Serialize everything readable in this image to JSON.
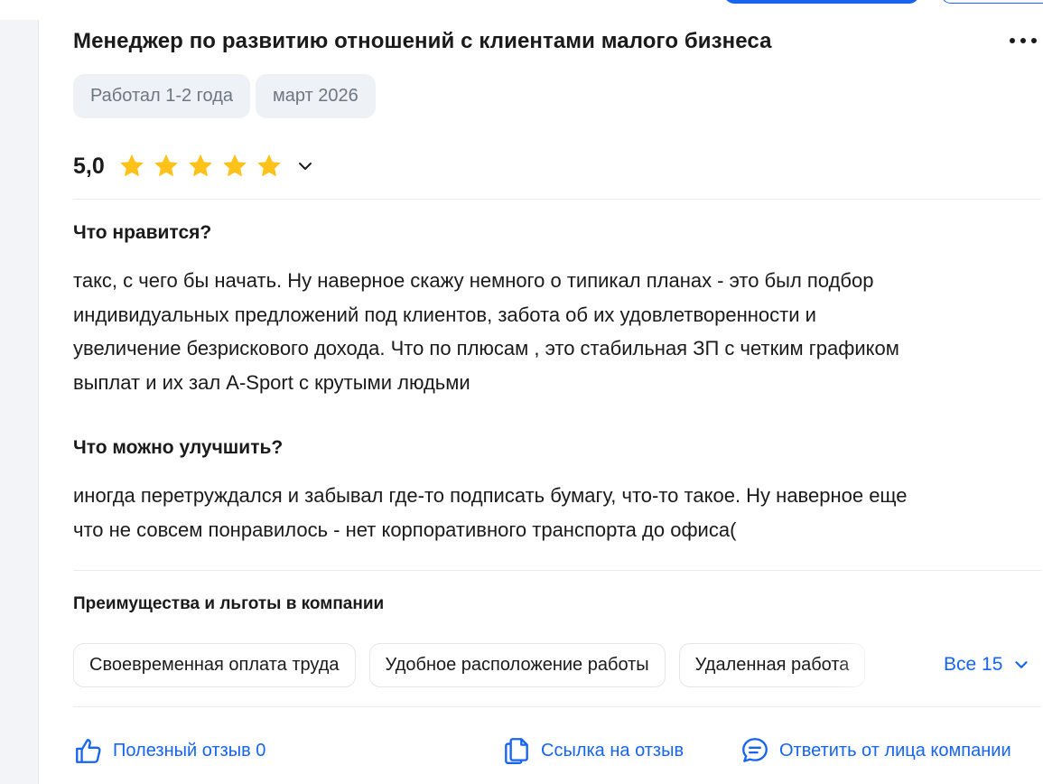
{
  "review": {
    "title": "Менеджер по развитию отношений с клиентами малого бизнеса",
    "tags": [
      "Работал 1-2 года",
      "март 2026"
    ],
    "rating": {
      "value_text": "5,0",
      "stars_filled": 5,
      "stars_total": 5
    },
    "pros": {
      "heading": "Что нравится?",
      "lines": [
        "такс, с чего бы начать. Ну наверное скажу немного о типикал планах - это был подбор",
        "индивидуальных предложений под клиентов, забота об их удовлетворенности и",
        "увеличение безрискового дохода. Что по плюсам , это стабильная ЗП с четким графиком",
        "выплат и их зал A-Sport с крутыми людьми"
      ]
    },
    "cons": {
      "heading": "Что можно улучшить?",
      "lines": [
        "иногда перетруждался и забывал где-то подписать бумагу, что-то такое. Ну наверное еще",
        "что не совсем понравилось - нет корпоративного транспорта до офиса("
      ]
    },
    "perks": {
      "title": "Преимущества и льготы в компании",
      "items": [
        "Своевременная оплата труда",
        "Удобное расположение работы",
        "Удаленная работа"
      ],
      "all_label": "Все 15"
    },
    "actions": {
      "helpful_label": "Полезный отзыв 0",
      "link_label": "Ссылка на отзыв",
      "reply_label": "Ответить от лица компании"
    }
  },
  "colors": {
    "accent": "#1664f0",
    "star": "#ffc21a",
    "tag_bg": "#eef1f6",
    "muted_text": "#6e7682"
  }
}
